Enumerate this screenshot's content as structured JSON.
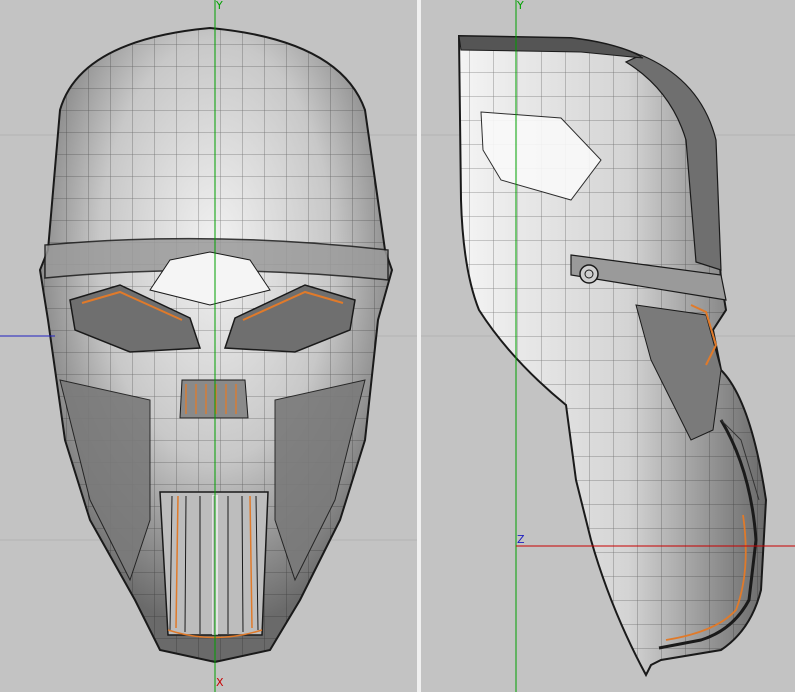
{
  "viewports": [
    {
      "id": "front",
      "axis_labels": {
        "vertical": "Y",
        "horizontal": "X"
      },
      "colors": {
        "vertical_axis": "#00a000",
        "horizontal_axis": "#c80000",
        "depth_axis": "#2020c0"
      }
    },
    {
      "id": "side",
      "axis_labels": {
        "vertical": "Y",
        "horizontal": "Z"
      },
      "colors": {
        "vertical_axis": "#00a000",
        "horizontal_axis": "#c80000",
        "depth_axis": "#2020c0"
      }
    }
  ],
  "colors": {
    "background": "#c3c3c3",
    "grid": "#b3b3b3",
    "mesh_light": "#e8e8e8",
    "mesh_mid": "#a9a9a9",
    "mesh_dark": "#6f6f6f",
    "wire": "#1a1a1a",
    "edge_highlight": "#e07a2a"
  }
}
